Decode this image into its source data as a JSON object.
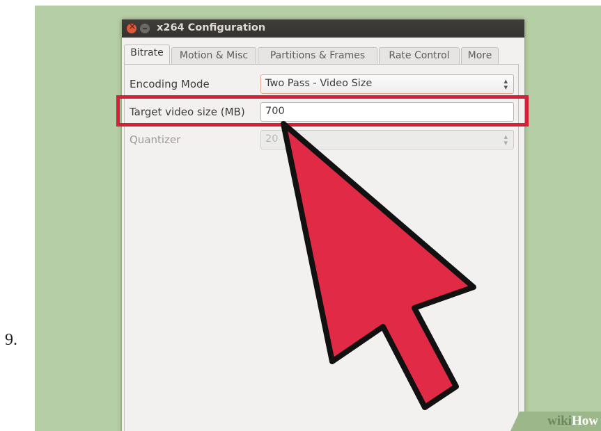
{
  "step_number": "9.",
  "window": {
    "title": "x264 Configuration"
  },
  "tabs": [
    {
      "label": "Bitrate",
      "active": true
    },
    {
      "label": "Motion & Misc",
      "active": false
    },
    {
      "label": "Partitions & Frames",
      "active": false
    },
    {
      "label": "Rate Control",
      "active": false
    },
    {
      "label": "More",
      "active": false
    }
  ],
  "form": {
    "encoding_mode": {
      "label": "Encoding Mode",
      "value": "Two Pass - Video Size"
    },
    "target_size": {
      "label": "Target video size (MB)",
      "value": "700"
    },
    "quantizer": {
      "label": "Quantizer",
      "value": "20"
    }
  },
  "colors": {
    "highlight": "#d6203a",
    "cursor_fill": "#e12a45",
    "background": "#b6cea5"
  },
  "watermark": {
    "part1": "wiki",
    "part2": "How"
  }
}
